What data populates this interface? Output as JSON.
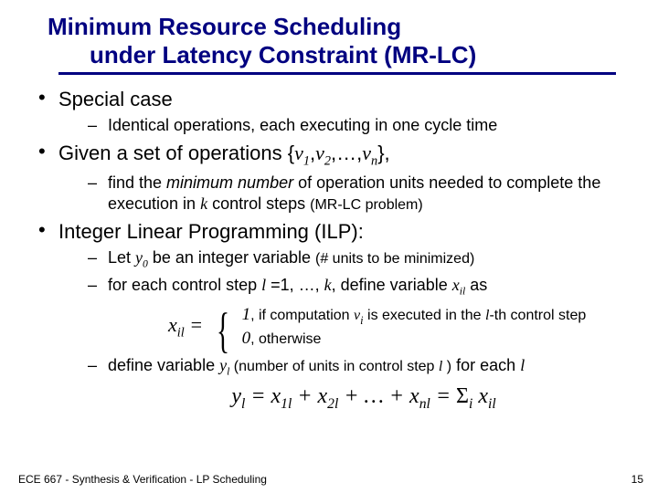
{
  "title": {
    "line1": "Minimum Resource Scheduling",
    "line2": "under Latency Constraint (MR-LC)"
  },
  "bullets": {
    "b1": "Special case",
    "b1a": "Identical operations, each executing in one cycle time",
    "b2_pre": "Given a set of operations {",
    "b2_v1": "v",
    "b2_s1": "1",
    "b2_c1": ",",
    "b2_v2": "v",
    "b2_s2": "2",
    "b2_c2": ",…,",
    "b2_vn": "v",
    "b2_sn": "n",
    "b2_post": "},",
    "b2a_pre": "find the ",
    "b2a_em": "minimum number",
    "b2a_mid": " of operation units needed to complete the execution in ",
    "b2a_k": "k",
    "b2a_post": " control steps ",
    "b2a_note": "(MR-LC problem)",
    "b3": "Integer Linear Programming (ILP):",
    "b3a_pre": "Let ",
    "b3a_y": "y",
    "b3a_s0": "0",
    "b3a_mid": " be an integer variable ",
    "b3a_note": "(# units to be minimized)",
    "b3b_pre": "for each control step ",
    "b3b_l1": "l",
    "b3b_mid": " =1, …, ",
    "b3b_k": "k",
    "b3b_mid2": ", define variable ",
    "b3b_x": "x",
    "b3b_il": "il",
    "b3b_post": " as",
    "pw_lhs_x": "x",
    "pw_lhs_il": "il",
    "pw_lhs_eq": " = ",
    "pw_r1_1": "1",
    "pw_r1_t1": ", if computation ",
    "pw_r1_v": "v",
    "pw_r1_i": "i",
    "pw_r1_t2": " is executed in the ",
    "pw_r1_l": "l",
    "pw_r1_t3": "-th control step",
    "pw_r2_0": "0",
    "pw_r2_t": ", otherwise",
    "b3c_pre": "define variable ",
    "b3c_y": "y",
    "b3c_l": "l",
    "b3c_note_pre": " (number of units in control step ",
    "b3c_note_l": "l",
    "b3c_note_post": " )",
    "b3c_post": " for each ",
    "b3c_l2": "l",
    "eq_y": "y",
    "eq_l": "l",
    "eq_eq1": " = ",
    "eq_x1": "x",
    "eq_s1": "1l",
    "eq_p1": " + ",
    "eq_x2": "x",
    "eq_s2": "2l",
    "eq_p2": " +  … + ",
    "eq_xn": "x",
    "eq_sn": "nl",
    "eq_eq2": " = ",
    "eq_sum": "Σ",
    "eq_sumi": "i",
    "eq_sp": " ",
    "eq_xi": "x",
    "eq_sil": "il"
  },
  "footer": "ECE 667 -  Synthesis & Verification - LP Scheduling",
  "page": "15"
}
